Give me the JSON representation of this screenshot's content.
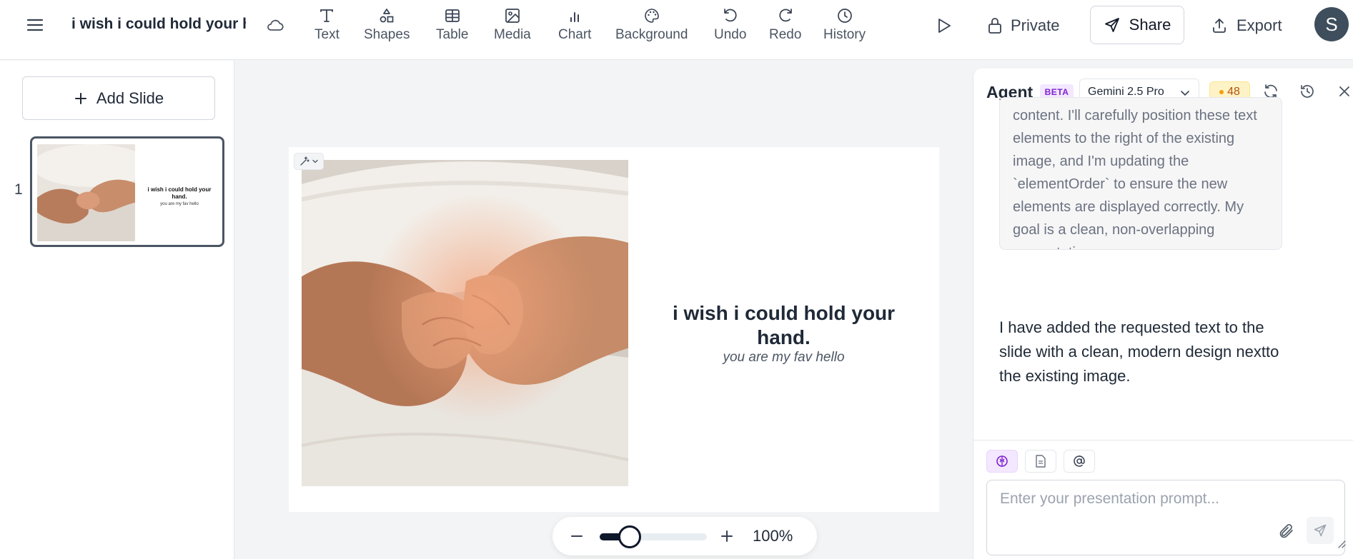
{
  "header": {
    "title": "i wish i could hold your hand.",
    "tools": [
      {
        "label": "Text",
        "icon": "text-icon"
      },
      {
        "label": "Shapes",
        "icon": "shapes-icon"
      },
      {
        "label": "Table",
        "icon": "table-icon"
      },
      {
        "label": "Media",
        "icon": "media-icon"
      },
      {
        "label": "Chart",
        "icon": "chart-icon"
      },
      {
        "label": "Background",
        "icon": "palette-icon"
      },
      {
        "label": "Undo",
        "icon": "undo-icon"
      },
      {
        "label": "Redo",
        "icon": "redo-icon"
      },
      {
        "label": "History",
        "icon": "history-icon"
      }
    ],
    "private_label": "Private",
    "share_label": "Share",
    "export_label": "Export",
    "avatar_initial": "S"
  },
  "slides_panel": {
    "add_slide_label": "Add Slide",
    "slides": [
      {
        "number": "1",
        "title": "i wish i could hold your hand.",
        "subtitle": "you are my fav hello"
      }
    ]
  },
  "slide": {
    "title": "i wish i could hold your hand.",
    "subtitle": "you are my fav hello",
    "image": "hands-holding-photo"
  },
  "zoom": {
    "value_label": "100%",
    "level_fraction": 0.28
  },
  "agent": {
    "title": "Agent",
    "badge": "BETA",
    "model": "Gemini 2.5 Pro",
    "credits": "48",
    "thinking_text": "content. I'll carefully position these text elements to the right of the existing image, and I'm updating the `elementOrder` to ensure the new elements are displayed correctly. My goal is a clean, non-overlapping presentation.",
    "reply_text": "I have added the requested text to the slide with a clean, modern design nextto the existing image.",
    "prompt_placeholder": "Enter your presentation prompt..."
  },
  "colors": {
    "accent_dark": "#0f172a",
    "beta_bg": "#f3e8ff",
    "beta_text": "#7e22ce",
    "credits_bg": "#fef3c7",
    "credits_text": "#b45309"
  }
}
